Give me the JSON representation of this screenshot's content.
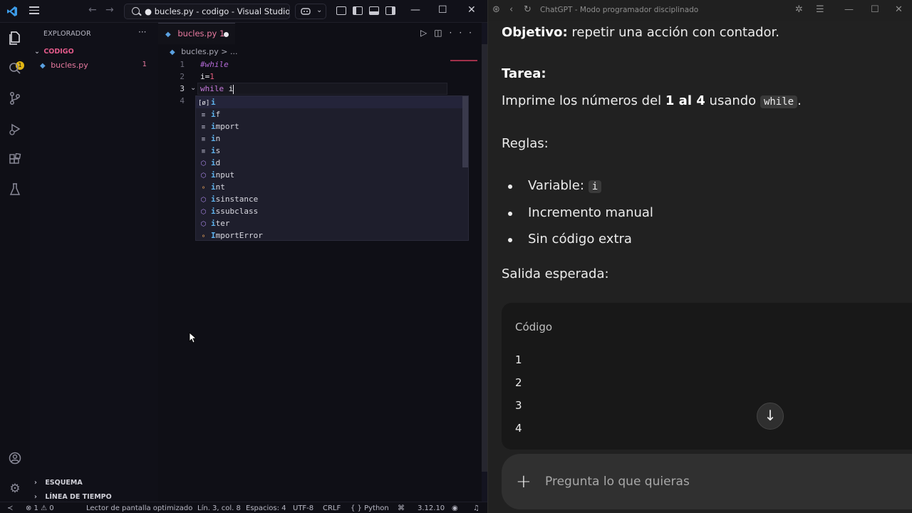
{
  "vscode": {
    "window_title": "● bucles.py - codigo - Visual Studio Code",
    "explorer_title": "EXPLORADOR",
    "folder_name": "CODIGO",
    "file_name": "bucles.py",
    "file_problem_count": "1",
    "outline_label": "ESQUEMA",
    "timeline_label": "LÍNEA DE TIEMPO",
    "tab_label": "bucles.py 1",
    "breadcrumb_file": "bucles.py",
    "breadcrumb_sep": "> ...",
    "line_numbers": [
      "1",
      "2",
      "3",
      "4"
    ],
    "code": {
      "line1": "#while",
      "line2_var": "i=",
      "line2_num": "1",
      "line3_kw": "while",
      "line3_rest": " i"
    },
    "suggestions": [
      {
        "kind": "[ø]",
        "kind_type": "var",
        "match": "i",
        "rest": ""
      },
      {
        "kind": "≡",
        "kind_type": "mod",
        "match": "i",
        "rest": "f"
      },
      {
        "kind": "≡",
        "kind_type": "mod",
        "match": "i",
        "rest": "mport"
      },
      {
        "kind": "≡",
        "kind_type": "mod",
        "match": "i",
        "rest": "n"
      },
      {
        "kind": "≡",
        "kind_type": "mod",
        "match": "i",
        "rest": "s"
      },
      {
        "kind": "⬡",
        "kind_type": "fn",
        "match": "i",
        "rest": "d"
      },
      {
        "kind": "⬡",
        "kind_type": "fn",
        "match": "i",
        "rest": "nput"
      },
      {
        "kind": "⚬",
        "kind_type": "cls",
        "match": "i",
        "rest": "nt"
      },
      {
        "kind": "⬡",
        "kind_type": "fn",
        "match": "i",
        "rest": "sinstance"
      },
      {
        "kind": "⬡",
        "kind_type": "fn",
        "match": "i",
        "rest": "ssubclass"
      },
      {
        "kind": "⬡",
        "kind_type": "fn",
        "match": "i",
        "rest": "ter"
      },
      {
        "kind": "⚬",
        "kind_type": "cls",
        "match": "I",
        "rest": "mportError"
      }
    ],
    "status": {
      "problems": "⊗ 1 ⚠ 0",
      "screen_reader": "Lector de pantalla optimizado",
      "position": "Lín. 3, col. 8",
      "spaces": "Espacios: 4",
      "encoding": "UTF-8",
      "eol": "CRLF",
      "language": "{ } Python",
      "python_version": "3.12.10"
    },
    "accent_color": "#e87aa0"
  },
  "chatgpt": {
    "window_title": "ChatGPT - Modo programador disciplinado",
    "objective_label": "Objetivo:",
    "objective_text": "repetir una acción con contador.",
    "task_label": "Tarea:",
    "task_pre": "Imprime los números del",
    "task_bold": "1 al 4",
    "task_mid": "usando",
    "task_code": "while",
    "task_end": ".",
    "rules_label": "Reglas:",
    "rule1_text": "Variable:",
    "rule1_code": "i",
    "rule2_text": "Incremento manual",
    "rule3_text": "Sin código extra",
    "expected_label": "Salida esperada:",
    "code_block_label": "Código",
    "output_lines": [
      "1",
      "2",
      "3",
      "4"
    ],
    "composer_placeholder": "Pregunta lo que quieras"
  }
}
